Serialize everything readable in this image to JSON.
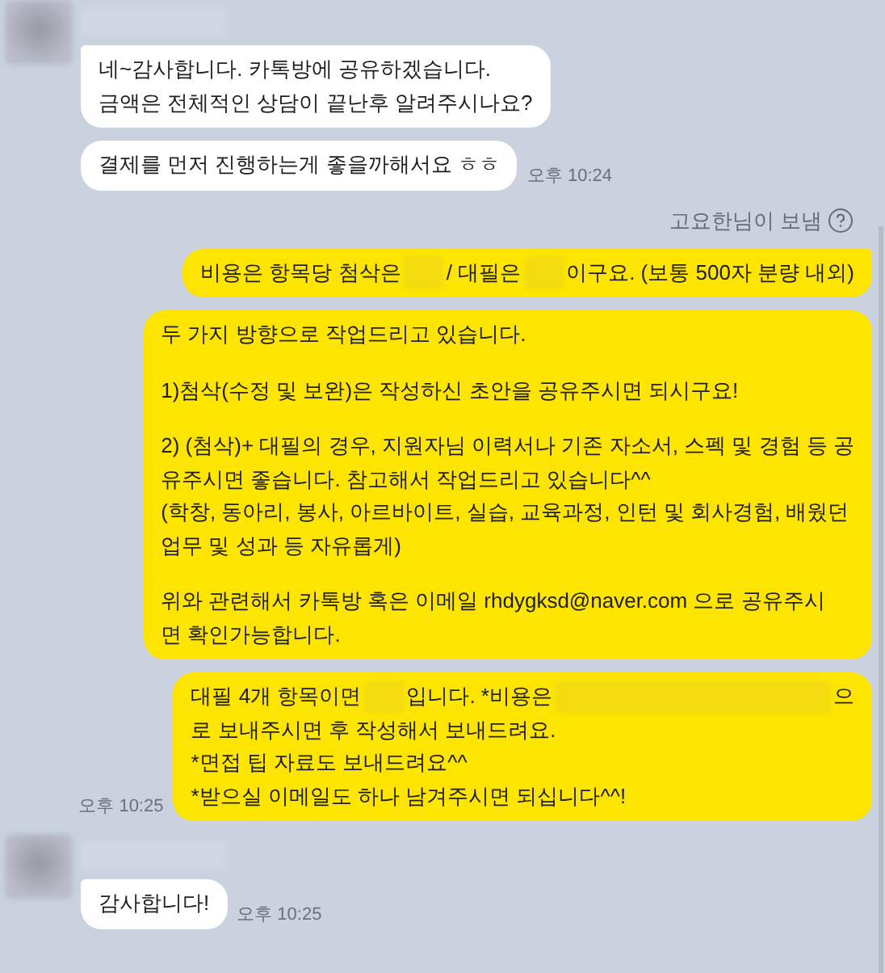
{
  "messages": [
    {
      "kind": "received",
      "bubbles": [
        {
          "paragraphs": [
            [
              "네~감사합니다. 카톡방에 공유하겠습니다.",
              "금액은 전체적인 상담이 끝난후 알려주시나요?"
            ]
          ]
        },
        {
          "paragraphs": [
            [
              "결제를 먼저 진행하는게 좋을까해서요 ㅎㅎ"
            ]
          ]
        }
      ],
      "time": "오후 10:24"
    },
    {
      "kind": "sent",
      "sender_note": "고요한님이 보냄",
      "bubbles": [
        {
          "paragraphs": [
            [
              {
                "parts": [
                  {
                    "text": "비용은 항목당 첨삭은"
                  },
                  {
                    "kind": "blur"
                  },
                  {
                    "text": "/ 대필은"
                  },
                  {
                    "kind": "blur"
                  },
                  {
                    "text": "이구요. (보통 500자 분량 내외)"
                  }
                ]
              }
            ]
          ]
        },
        {
          "paragraphs": [
            [
              "두 가지 방향으로 작업드리고 있습니다."
            ],
            [
              "1)첨삭(수정 및 보완)은 작성하신 초안을 공유주시면 되시구요!"
            ],
            [
              "2) (첨삭)+ 대필의 경우, 지원자님 이력서나 기존 자소서, 스펙 및 경험 등 공",
              "유주시면 좋습니다. 참고해서 작업드리고 있습니다^^",
              "(학창, 동아리, 봉사, 아르바이트, 실습, 교육과정, 인턴 및 회사경험, 배웠던",
              "업무 및 성과 등 자유롭게)"
            ],
            [
              "위와 관련해서 카톡방 혹은 이메일 rhdygksd@naver.com 으로 공유주시",
              "면 확인가능합니다."
            ]
          ]
        },
        {
          "paragraphs": [
            [
              {
                "parts": [
                  {
                    "text": "대필 4개 항목이면"
                  },
                  {
                    "kind": "blur"
                  },
                  {
                    "text": "입니다. *비용은"
                  },
                  {
                    "kind": "blur-wide"
                  },
                  {
                    "text": "으"
                  }
                ]
              },
              "로 보내주시면 후 작성해서 보내드려요.",
              "*면접 팁 자료도 보내드려요^^",
              "*받으실 이메일도 하나 남겨주시면 되십니다^^!"
            ]
          ]
        }
      ],
      "time": "오후 10:25"
    },
    {
      "kind": "received",
      "bubbles": [
        {
          "paragraphs": [
            [
              "감사합니다!"
            ]
          ]
        }
      ],
      "time": "오후 10:25"
    }
  ]
}
